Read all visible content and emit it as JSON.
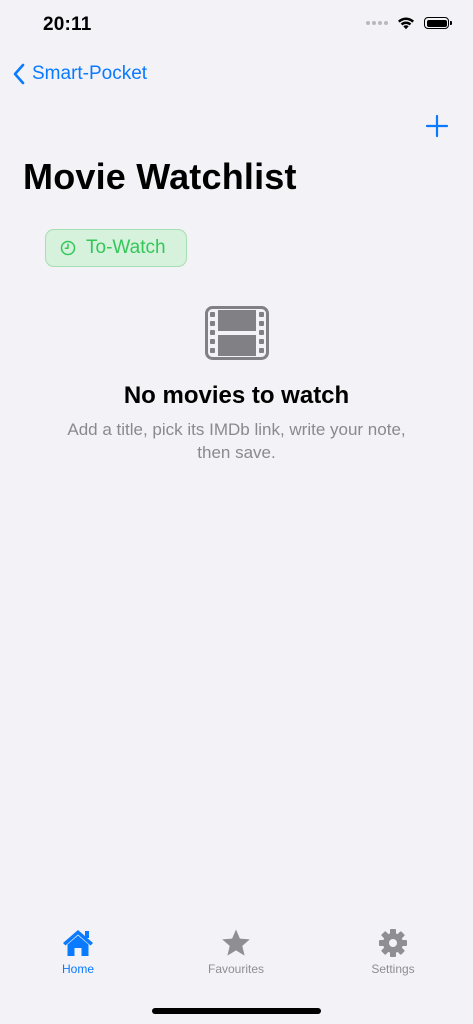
{
  "status_bar": {
    "time": "20:11"
  },
  "nav": {
    "back_label": "Smart-Pocket",
    "add_icon": "plus-icon"
  },
  "page": {
    "title": "Movie Watchlist"
  },
  "filter": {
    "label": "To-Watch",
    "icon": "clock-icon",
    "color": "#34c759"
  },
  "empty_state": {
    "icon": "film-icon",
    "title": "No movies to watch",
    "text": "Add a title, pick its IMDb link, write your note, then save."
  },
  "tabs": [
    {
      "label": "Home",
      "icon": "house-icon",
      "active": true
    },
    {
      "label": "Favourites",
      "icon": "star-icon",
      "active": false
    },
    {
      "label": "Settings",
      "icon": "gear-icon",
      "active": false
    }
  ],
  "colors": {
    "accent": "#0a7aff",
    "background": "#f2f2f7",
    "inactive": "#8e8e93"
  }
}
